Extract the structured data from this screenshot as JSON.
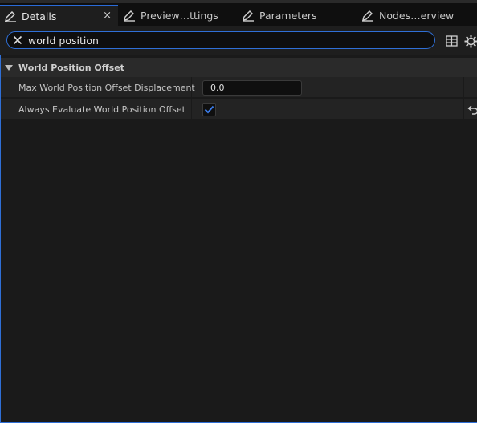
{
  "tabs": [
    {
      "label": "Details",
      "icon": "pencil-icon",
      "active": true,
      "close": "×"
    },
    {
      "label": "Preview…ttings",
      "icon": "pencil-icon",
      "active": false
    },
    {
      "label": "Parameters",
      "icon": "pencil-icon",
      "active": false
    },
    {
      "label": "Nodes…erview",
      "icon": "pencil-icon",
      "active": false
    }
  ],
  "search": {
    "value": "world position",
    "clear_icon": "close-icon",
    "accent": "#2f6fd6"
  },
  "toolbar": {
    "table_icon": "table-view-icon",
    "settings_icon": "gear-icon"
  },
  "category": {
    "title": "World Position Offset",
    "expanded": true
  },
  "properties": [
    {
      "name": "Max World Position Offset Displacement",
      "value": "0.0",
      "type": "number"
    },
    {
      "name": "Always Evaluate World Position Offset",
      "checked": true,
      "type": "checkbox",
      "reset_icon": "reset-arrow-icon"
    }
  ],
  "colors": {
    "accent": "#2a6bd8",
    "check": "#3b7be8"
  }
}
